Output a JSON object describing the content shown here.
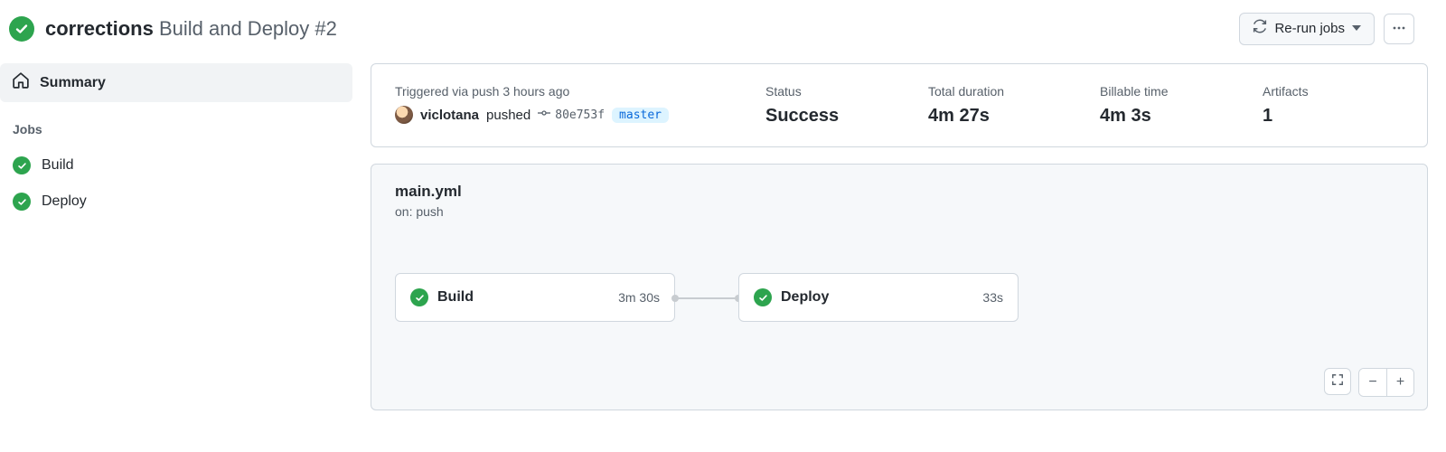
{
  "header": {
    "run_title_bold": "corrections",
    "run_title_rest": "Build and Deploy #2",
    "rerun_label": "Re-run jobs"
  },
  "sidebar": {
    "summary_label": "Summary",
    "jobs_heading": "Jobs",
    "jobs": [
      {
        "name": "Build"
      },
      {
        "name": "Deploy"
      }
    ]
  },
  "summary": {
    "trigger_label": "Triggered via push 3 hours ago",
    "actor": "viclotana",
    "pushed_word": "pushed",
    "commit_sha": "80e753f",
    "branch": "master",
    "status_label": "Status",
    "status_value": "Success",
    "duration_label": "Total duration",
    "duration_value": "4m 27s",
    "billable_label": "Billable time",
    "billable_value": "4m 3s",
    "artifacts_label": "Artifacts",
    "artifacts_value": "1"
  },
  "workflow": {
    "file": "main.yml",
    "on_line": "on: push",
    "nodes": [
      {
        "name": "Build",
        "duration": "3m 30s"
      },
      {
        "name": "Deploy",
        "duration": "33s"
      }
    ]
  },
  "icons": {
    "success": "check-circle",
    "home": "home-icon",
    "sync": "sync-icon",
    "caret": "triangle-down-icon",
    "kebab": "kebab-icon",
    "commit": "git-commit-icon",
    "fullscreen": "fullscreen-icon",
    "minus": "minus-icon",
    "plus": "plus-icon"
  },
  "colors": {
    "success_green": "#2da44e",
    "link_blue": "#0969da",
    "muted": "#57606a",
    "border": "#d0d7de",
    "panel_bg": "#f6f8fa"
  }
}
